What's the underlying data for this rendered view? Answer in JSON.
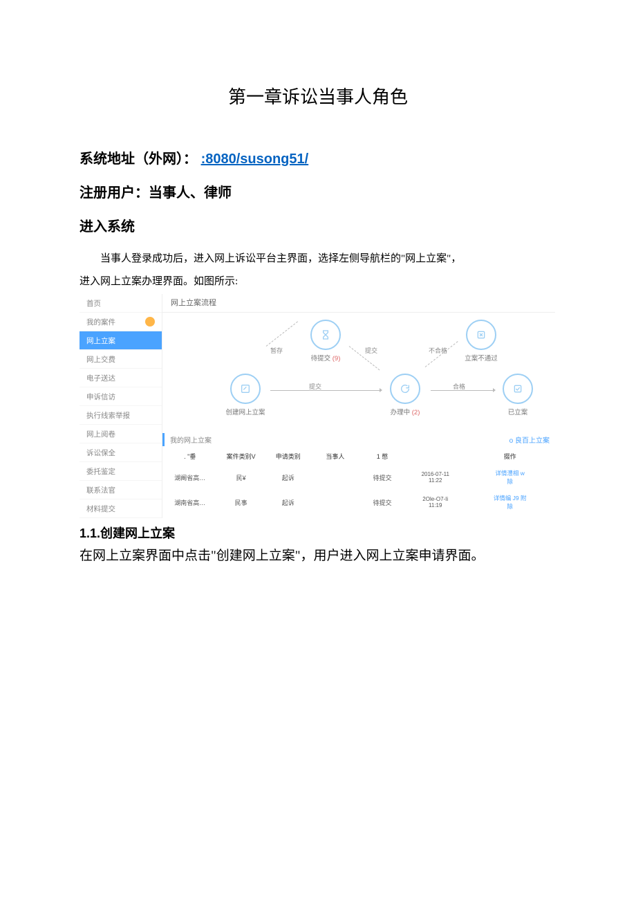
{
  "chapter_title": "第一章诉讼当事人角色",
  "sys_addr_label": "系统地址（外网）：",
  "sys_addr_link": ":8080/susong51/",
  "register_line": "注册用户：当事人、律师",
  "enter_system_heading": "进入系统",
  "intro_para": "当事人登录成功后，进入网上诉讼平台主界面，选择左侧导航栏的\"网上立案\"，",
  "intro_para_2": "进入网上立案办理界面。如图所示:",
  "nav": {
    "items": [
      {
        "label": "首页",
        "active": false,
        "badge": false
      },
      {
        "label": "我的案件",
        "active": false,
        "badge": true
      },
      {
        "label": "网上立案",
        "active": true,
        "badge": false
      },
      {
        "label": "网上交费",
        "active": false,
        "badge": false
      },
      {
        "label": "电子送达",
        "active": false,
        "badge": false
      },
      {
        "label": "申诉信访",
        "active": false,
        "badge": false
      },
      {
        "label": "执行线索举报",
        "active": false,
        "badge": false
      },
      {
        "label": "网上阅卷",
        "active": false,
        "badge": false
      },
      {
        "label": "诉讼保全",
        "active": false,
        "badge": false
      },
      {
        "label": "委托鉴定",
        "active": false,
        "badge": false
      },
      {
        "label": "联系法官",
        "active": false,
        "badge": false
      },
      {
        "label": "材料提交",
        "active": false,
        "badge": false
      }
    ]
  },
  "flow": {
    "title": "网上立案流程",
    "nodes": {
      "create": "创建网上立案",
      "pending": "待提交",
      "pending_count": "(9)",
      "processing": "办理中",
      "processing_count": "(2)",
      "rejected": "立案不通过",
      "filed": "已立案"
    },
    "edges": {
      "save": "暂存",
      "submit": "提交",
      "fail": "不合格",
      "pass": "合格"
    }
  },
  "list": {
    "title": "我的网上立案",
    "create_btn": "良百上立案",
    "cols": {
      "court": ". \"垂",
      "casetype": "案件类别V",
      "apptype": "申请类别",
      "party": "当事人",
      "status": "1 憋",
      "time": "",
      "ops": "掇作"
    },
    "rows": [
      {
        "court": "湖阚省高…",
        "casetype": "民¥",
        "apptype": "起诉",
        "party": "",
        "status": "待提交",
        "time_top": "2016-07-11",
        "time_bot": "11:22",
        "op1": "详情澧相 w",
        "op2": "除"
      },
      {
        "court": "湖南省高…",
        "casetype": "民事",
        "apptype": "起诉",
        "party": "",
        "status": "待提交",
        "time_top": "2Ole-O7-Ii",
        "time_bot": "11:19",
        "op1": "详情编 J9 附",
        "op2": "除"
      }
    ]
  },
  "section11": {
    "title": "1.1.创建网上立案",
    "body": "在网上立案界面中点击\"创建网上立案\"，用户进入网上立案申请界面。"
  }
}
